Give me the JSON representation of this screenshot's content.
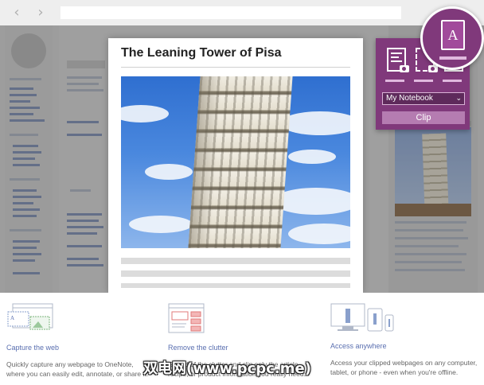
{
  "browser": {
    "back_icon": "chevron-left-icon",
    "forward_icon": "chevron-right-icon"
  },
  "clip_preview": {
    "title": "The Leaning Tower of Pisa"
  },
  "clipper": {
    "modes": [
      "full-page-icon",
      "region-icon",
      "article-icon"
    ],
    "notebook_select": "My Notebook",
    "clip_button": "Clip",
    "badge_letter": "A"
  },
  "features": [
    {
      "title": "Capture the web",
      "desc": [
        "Quickly capture any webpage to OneNote,",
        "where you can easily edit, annotate, or share it."
      ]
    },
    {
      "title": "Remove the clutter",
      "desc": [
        "Get rid of the clutter and clip only the article,",
        "recipe, or product information you really need."
      ]
    },
    {
      "title": "Access anywhere",
      "desc": [
        "Access your clipped webpages on any computer,",
        "tablet, or phone - even when you're offline."
      ]
    }
  ],
  "watermark": "双电网(www.pcpc.me)",
  "colors": {
    "accent_purple": "#80397b",
    "link_blue": "#5a6fb0"
  }
}
